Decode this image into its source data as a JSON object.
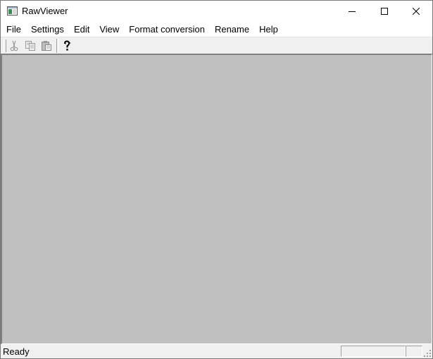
{
  "window": {
    "title": "RawViewer"
  },
  "menubar": {
    "items": [
      {
        "label": "File"
      },
      {
        "label": "Settings"
      },
      {
        "label": "Edit"
      },
      {
        "label": "View"
      },
      {
        "label": "Format conversion"
      },
      {
        "label": "Rename"
      },
      {
        "label": "Help"
      }
    ]
  },
  "toolbar": {
    "buttons": [
      {
        "icon": "cut-icon",
        "enabled": false
      },
      {
        "icon": "copy-icon",
        "enabled": false
      },
      {
        "icon": "paste-icon",
        "enabled": false
      },
      {
        "icon": "help-icon",
        "enabled": true
      }
    ]
  },
  "statusbar": {
    "text": "Ready"
  },
  "colors": {
    "client_background": "#c0c0c0",
    "chrome": "#f0f0f0"
  }
}
